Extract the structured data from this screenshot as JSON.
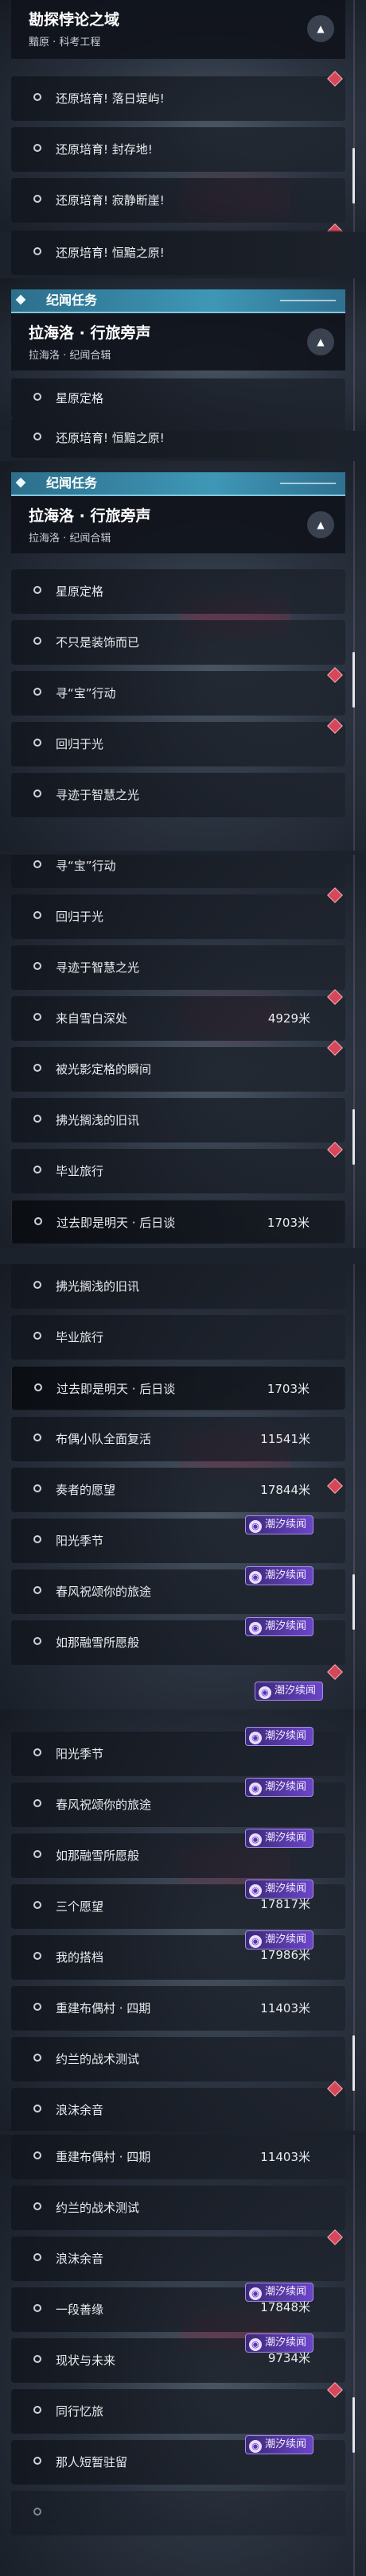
{
  "panel_top": {
    "title": "勘探悖论之域",
    "subtitle": "黯原 · 科考工程"
  },
  "header_label": "纪闻任务",
  "panel_mid": {
    "title": "拉海洛 · 行旅旁声",
    "subtitle": "拉海洛 · 纪闻合辑"
  },
  "collapse_icon": "chevron-up-icon",
  "badge_label": "潮汐续闻",
  "colors": {
    "accent": "#3f97b6",
    "badge": "#6b45c8",
    "marker": "#d6475a"
  },
  "quests": {
    "q_huanyuan1": "还原培育! 落日堤屿!",
    "q_huanyuan2": "还原培育! 封存地!",
    "q_huanyuan3": "还原培育! 寂静断崖!",
    "q_huanyuan4": "还原培育! 恒黯之原!",
    "q_xingyuan": "星原定格",
    "q_bushi": "不只是装饰而已",
    "q_xunbao": "寻“宝”行动",
    "q_huigui": "回归于光",
    "q_xunji": "寻迹于智慧之光",
    "q_xuebai": "来自雪白深处",
    "q_beiguang": "被光影定格的瞬间",
    "q_fuguang": "拂光搁浅的旧讯",
    "q_biye": "毕业旅行",
    "q_guoqu": "过去即是明天 · 后日谈",
    "q_buou": "布偶小队全面复活",
    "q_zouzhe": "奏者的愿望",
    "q_yangguang": "阳光季节",
    "q_chunfeng": "春风祝颂你的旅途",
    "q_runa": "如那融雪所愿般",
    "q_sange": "三个愿望",
    "q_dadang": "我的搭档",
    "q_chongjian": "重建布偶村 · 四期",
    "q_yuelan": "约兰的战术测试",
    "q_langmo": "浪沫余音",
    "q_yiduan": "一段善缘",
    "q_xianzhuang": "现状与未来",
    "q_tongxing": "同行忆旅",
    "q_naren": "那人短暂驻留"
  },
  "distances": {
    "xuebai": "4929米",
    "guoqu": "1703米",
    "buou": "11541米",
    "zouzhe": "17844米",
    "sange": "17817米",
    "dadang": "17986米",
    "chongjian": "11403米",
    "yiduan": "17848米",
    "xianzhuang": "9734米"
  }
}
